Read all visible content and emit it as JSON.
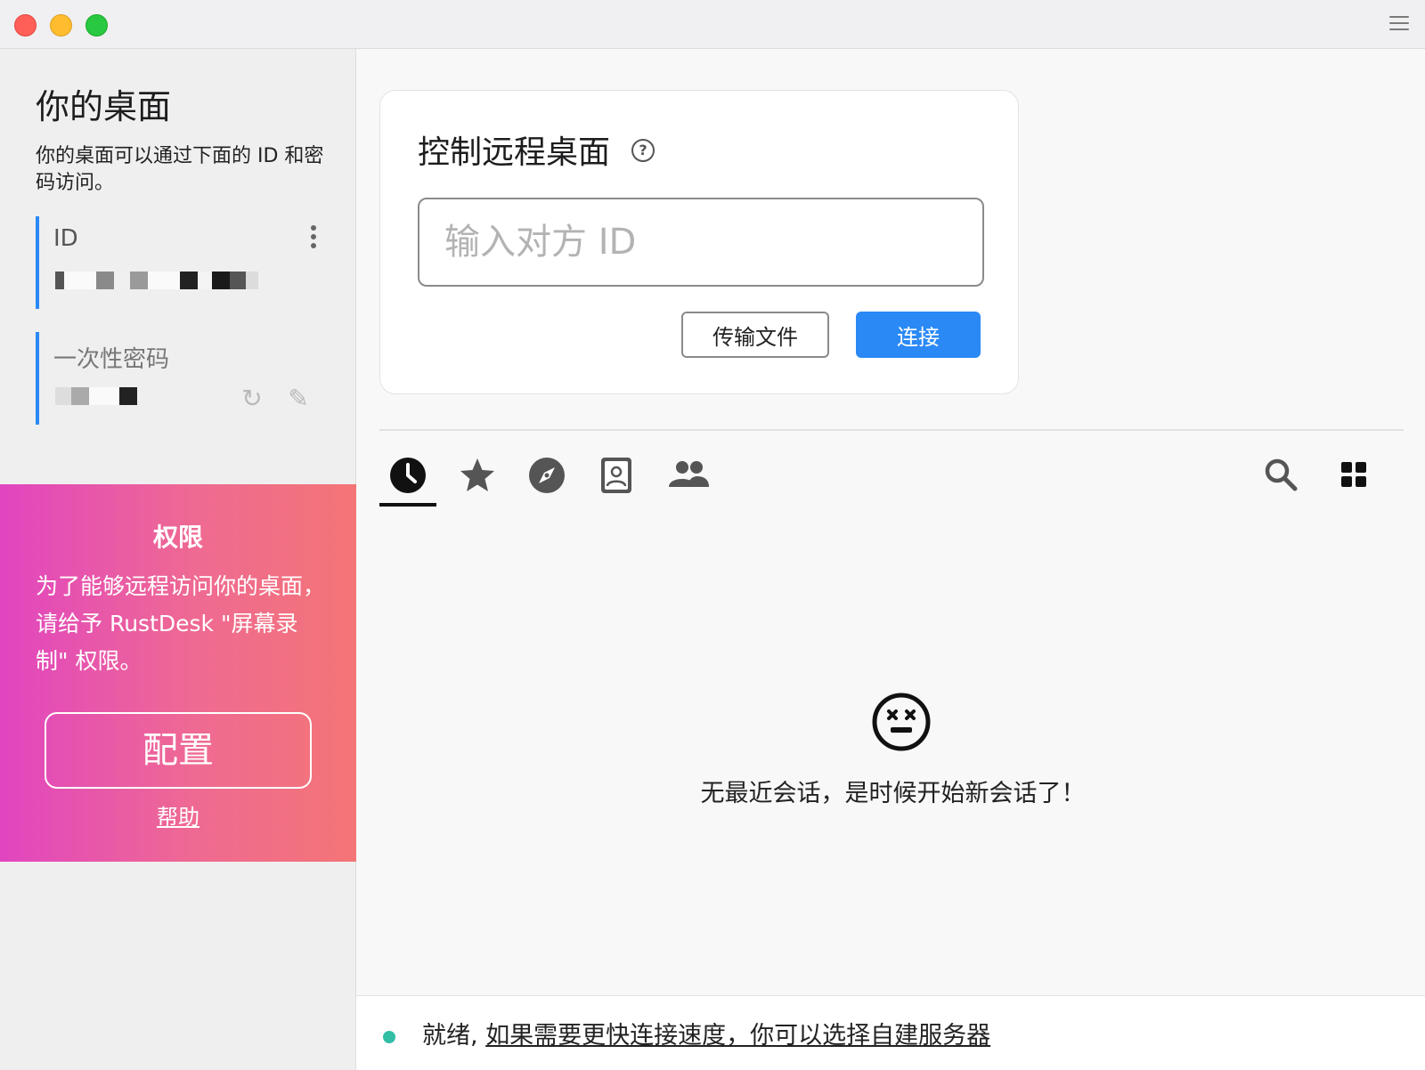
{
  "left": {
    "title": "你的桌面",
    "description": "你的桌面可以通过下面的 ID 和密码访问。",
    "id_label": "ID",
    "password_label": "一次性密码"
  },
  "permission": {
    "title": "权限",
    "body": "为了能够远程访问你的桌面，请给予 RustDesk \"屏幕录制\" 权限。",
    "configure_label": "配置",
    "help_label": "帮助"
  },
  "connect": {
    "title": "控制远程桌面",
    "help_glyph": "?",
    "id_placeholder": "输入对方 ID",
    "transfer_label": "传输文件",
    "connect_label": "连接"
  },
  "tabs": [
    {
      "icon": "recent-clock-icon"
    },
    {
      "icon": "favorites-star-icon"
    },
    {
      "icon": "discovered-compass-icon"
    },
    {
      "icon": "address-book-icon"
    },
    {
      "icon": "group-people-icon"
    }
  ],
  "empty": {
    "message": "无最近会话，是时候开始新会话了！"
  },
  "status": {
    "state": "就绪,",
    "link": "如果需要更快连接速度，你可以选择自建服务器",
    "dot_color": "#32bea6"
  },
  "colors": {
    "accent": "#2a89f5",
    "permission_gradient_start": "#e145c0",
    "permission_gradient_end": "#f47576"
  }
}
